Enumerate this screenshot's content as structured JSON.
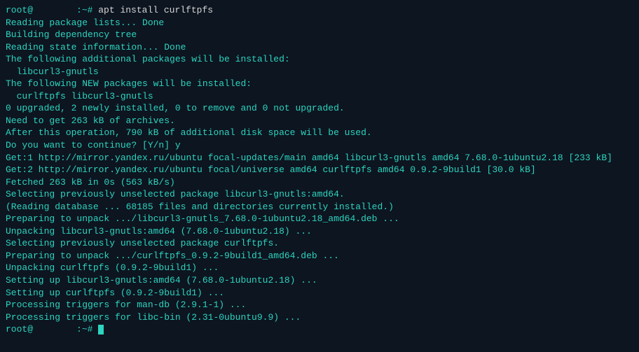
{
  "prompt1": {
    "user": "root@",
    "hostpath": ":~# ",
    "command": "apt install curlftpfs"
  },
  "lines": [
    "Reading package lists... Done",
    "Building dependency tree",
    "Reading state information... Done",
    "The following additional packages will be installed:",
    "  libcurl3-gnutls",
    "The following NEW packages will be installed:",
    "  curlftpfs libcurl3-gnutls",
    "0 upgraded, 2 newly installed, 0 to remove and 0 not upgraded.",
    "Need to get 263 kB of archives.",
    "After this operation, 790 kB of additional disk space will be used.",
    "Do you want to continue? [Y/n] y",
    "Get:1 http://mirror.yandex.ru/ubuntu focal-updates/main amd64 libcurl3-gnutls amd64 7.68.0-1ubuntu2.18 [233 kB]",
    "Get:2 http://mirror.yandex.ru/ubuntu focal/universe amd64 curlftpfs amd64 0.9.2-9build1 [30.0 kB]",
    "Fetched 263 kB in 0s (563 kB/s)",
    "Selecting previously unselected package libcurl3-gnutls:amd64.",
    "(Reading database ... 68185 files and directories currently installed.)",
    "Preparing to unpack .../libcurl3-gnutls_7.68.0-1ubuntu2.18_amd64.deb ...",
    "Unpacking libcurl3-gnutls:amd64 (7.68.0-1ubuntu2.18) ...",
    "Selecting previously unselected package curlftpfs.",
    "Preparing to unpack .../curlftpfs_0.9.2-9build1_amd64.deb ...",
    "Unpacking curlftpfs (0.9.2-9build1) ...",
    "Setting up libcurl3-gnutls:amd64 (7.68.0-1ubuntu2.18) ...",
    "Setting up curlftpfs (0.9.2-9build1) ...",
    "Processing triggers for man-db (2.9.1-1) ...",
    "Processing triggers for libc-bin (2.31-0ubuntu9.9) ..."
  ],
  "prompt2": {
    "user": "root@",
    "hostpath": ":~# "
  }
}
